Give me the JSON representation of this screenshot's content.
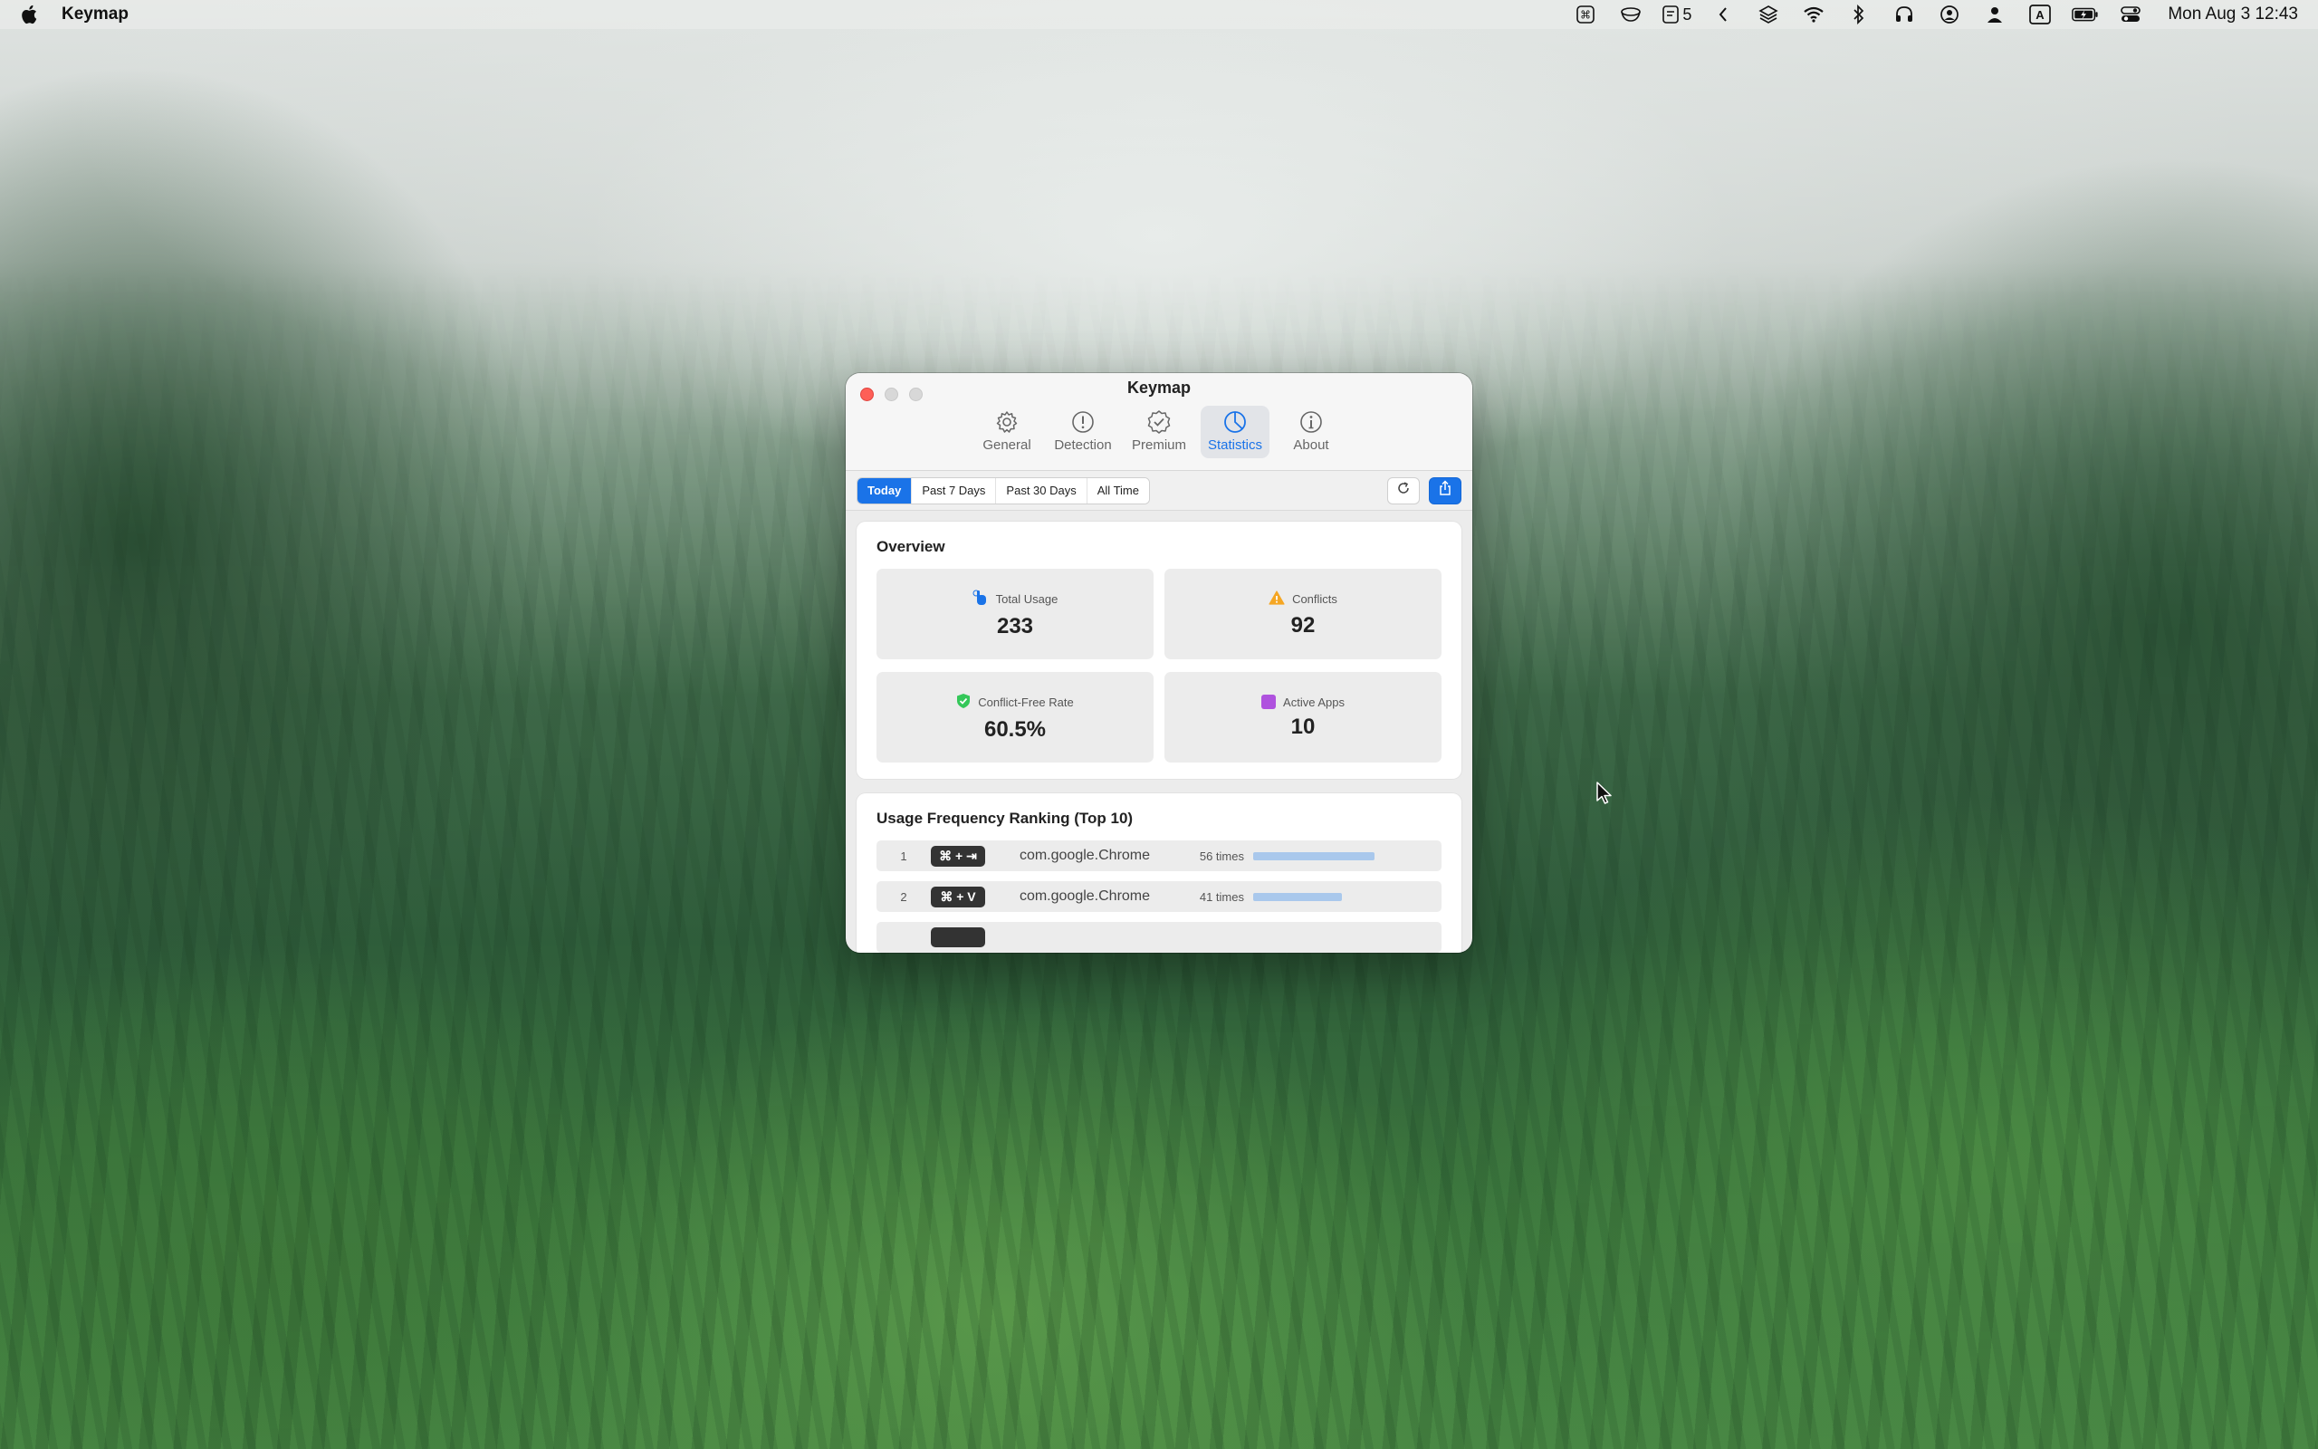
{
  "menubar": {
    "app_name": "Keymap",
    "badge_count": "5",
    "clock": "Mon Aug 3  12:43"
  },
  "window": {
    "title": "Keymap",
    "toolbar": [
      {
        "label": "General",
        "icon": "gear-icon"
      },
      {
        "label": "Detection",
        "icon": "exclamation-circle-icon"
      },
      {
        "label": "Premium",
        "icon": "checkmark-seal-icon"
      },
      {
        "label": "Statistics",
        "icon": "pie-chart-icon",
        "active": true
      },
      {
        "label": "About",
        "icon": "info-circle-icon"
      }
    ],
    "filters": {
      "ranges": [
        "Today",
        "Past 7 Days",
        "Past 30 Days",
        "All Time"
      ],
      "selected": "Today"
    },
    "overview": {
      "title": "Overview",
      "stats": [
        {
          "label": "Total Usage",
          "value": "233",
          "icon": "hand-tap-icon",
          "color": "#1a73e8"
        },
        {
          "label": "Conflicts",
          "value": "92",
          "icon": "warning-icon",
          "color": "#f5a623"
        },
        {
          "label": "Conflict-Free Rate",
          "value": "60.5%",
          "icon": "shield-check-icon",
          "color": "#34c759"
        },
        {
          "label": "Active Apps",
          "value": "10",
          "icon": "app-square-icon",
          "color": "#af52de"
        }
      ]
    },
    "ranking": {
      "title": "Usage Frequency Ranking (Top 10)",
      "rows": [
        {
          "rank": "1",
          "shortcut": "⌘ + ⇥",
          "app": "com.google.Chrome",
          "count": "56 times",
          "fraction": 1.0
        },
        {
          "rank": "2",
          "shortcut": "⌘ + V",
          "app": "com.google.Chrome",
          "count": "41 times",
          "fraction": 0.73
        }
      ]
    }
  }
}
